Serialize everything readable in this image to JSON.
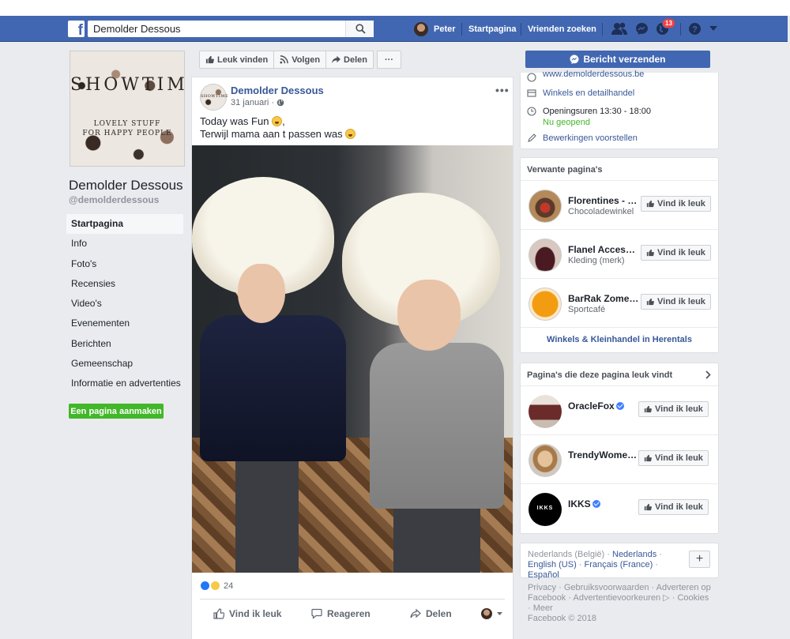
{
  "topbar": {
    "search_value": "Demolder Dessous",
    "profile_name": "Peter",
    "home_label": "Startpagina",
    "find_friends_label": "Vrienden zoeken",
    "notification_count": "13"
  },
  "page": {
    "cover_brand": "SHOWTIME",
    "cover_tagline_1": "LOVELY STUFF",
    "cover_tagline_2": "FOR HAPPY PEOPLE",
    "name": "Demolder Dessous",
    "handle": "@demolderdessous",
    "nav": [
      {
        "label": "Startpagina"
      },
      {
        "label": "Info"
      },
      {
        "label": "Foto's"
      },
      {
        "label": "Recensies"
      },
      {
        "label": "Video's"
      },
      {
        "label": "Evenementen"
      },
      {
        "label": "Berichten"
      },
      {
        "label": "Gemeenschap"
      },
      {
        "label": "Informatie en advertenties"
      }
    ],
    "create_page_label": "Een pagina aanmaken"
  },
  "actions": {
    "like_label": "Leuk vinden",
    "follow_label": "Volgen",
    "share_label": "Delen",
    "more_label": "···"
  },
  "post": {
    "author": "Demolder Dessous",
    "date": "31 januari",
    "line1": "Today was Fun",
    "line2": "Terwijl mama aan t passen was",
    "reaction_count": "24",
    "like_action": "Vind ik leuk",
    "comment_action": "Reageren",
    "share_action": "Delen"
  },
  "sidebar": {
    "message_button": "Bericht verzenden",
    "website": "www.demolderdessous.be",
    "category": "Winkels en detailhandel",
    "hours": "Openingsuren 13:30 - 18:00",
    "open_status": "Nu geopend",
    "suggest_edits": "Bewerkingen voorstellen",
    "related_title": "Verwante pagina's",
    "related": [
      {
        "name": "Florentines - Bi...",
        "sub": "Chocoladewinkel"
      },
      {
        "name": "Flanel Accesso...",
        "sub": "Kleding (merk)"
      },
      {
        "name": "BarRak Zomer...",
        "sub": "Sportcafé"
      }
    ],
    "related_like_label": "Vind ik leuk",
    "related_more": "Winkels & Kleinhandel in Herentals",
    "liked_title": "Pagina's die deze pagina leuk vindt",
    "liked": [
      {
        "name": "OracleFox"
      },
      {
        "name": "TrendyWomen..."
      },
      {
        "name": "IKKS"
      }
    ],
    "languages_current": "Nederlands (België)",
    "languages_links": [
      "Nederlands",
      "English (US)",
      "Français (France)",
      "Español"
    ],
    "footer_links": [
      "Privacy",
      "Gebruiksvoorwaarden",
      "Adverteren op Facebook",
      "Advertentievoorkeuren",
      "Cookies",
      "Meer"
    ],
    "copyright": "Facebook © 2018"
  },
  "colors": {
    "brand_blue": "#4267b2",
    "link_blue": "#385898",
    "green": "#42b72a",
    "notif_red": "#fa3e3e"
  }
}
